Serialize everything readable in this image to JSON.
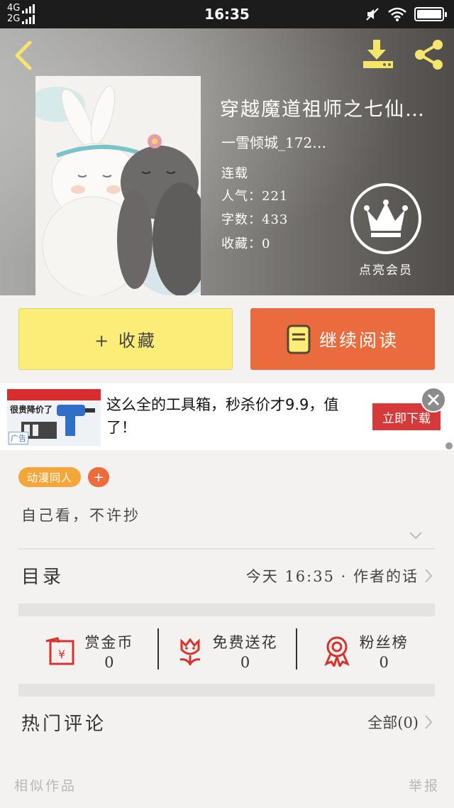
{
  "status_bar": {
    "network_top": "4G",
    "network_bottom": "2G",
    "time": "16:35"
  },
  "header": {
    "back_icon": "chevron-left-icon",
    "download_icon": "download-icon",
    "share_icon": "share-icon",
    "accent": "#f5e56a"
  },
  "book": {
    "title": "穿越魔道祖师之七仙…",
    "author": "一雪倾城_172…",
    "status": "连载",
    "popularity": "人气：221",
    "words": "字数：433",
    "favorites": "收藏：0",
    "vip_label": "点亮会员"
  },
  "actions": {
    "favorite_label": "+ 收藏",
    "read_label": "继续阅读",
    "favorite_color": "#fbed78",
    "read_color": "#ea6b3d"
  },
  "ad": {
    "image_label": "很贵降价了",
    "tag": "广告",
    "text": "这么全的工具箱，秒杀价才9.9，值了！",
    "cta": "立即下载"
  },
  "detail": {
    "tag": "动漫同人",
    "tag_add": "+",
    "description": "自己看，不许抄",
    "toc_label": "目录",
    "toc_time": "今天 16:35 · 作者的话",
    "stats": [
      {
        "icon": "red-envelope-icon",
        "label": "赏金币",
        "value": "0"
      },
      {
        "icon": "flower-icon",
        "label": "免费送花",
        "value": "0"
      },
      {
        "icon": "award-ribbon-icon",
        "label": "粉丝榜",
        "value": "0"
      }
    ],
    "hot_label": "热门评论",
    "hot_all": "全部(0)",
    "similar": "相似作品",
    "report": "举报"
  }
}
